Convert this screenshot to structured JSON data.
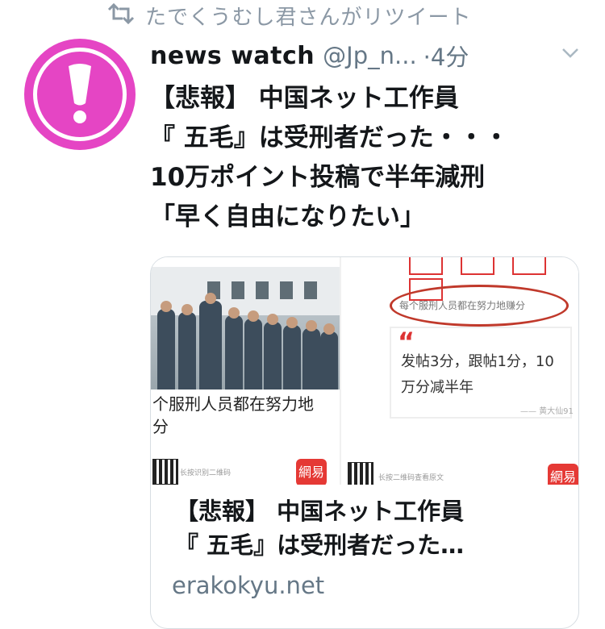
{
  "retweet": {
    "icon": "retweet-icon",
    "text": "たでくうむし君さんがリツイート"
  },
  "tweet": {
    "avatar_color": "#e545c4",
    "author_name": "news watch",
    "author_handle": "@Jp_n...",
    "time": "·4分",
    "menu_icon": "chevron-down-icon",
    "text_lines": [
      "【悲報】 中国ネット工作員",
      "『 五毛』は受刑者だった・・・",
      "10万ポイント投稿で半年減刑",
      "「早く自由になりたい」"
    ]
  },
  "card": {
    "left_caption_lines": [
      "个服刑人员都在努力地",
      "分"
    ],
    "left_qr_caption": "长按识别二维码",
    "right_highlight": "每个服刑人员都在努力地赚分",
    "right_quote_lines": [
      "发帖3分，跟帖1分，10",
      "万分减半年"
    ],
    "right_quote_source": "—— 黄大仙91",
    "right_qr_caption": "长按二维码查看原文",
    "logo_text": "網易",
    "title_lines": [
      "【悲報】 中国ネット工作員",
      "『 五毛』は受刑者だった…"
    ],
    "domain": "erakokyu.net"
  },
  "colors": {
    "accent_gray": "#8b98a5",
    "text_dark": "#14171a",
    "link_gray": "#657786"
  }
}
